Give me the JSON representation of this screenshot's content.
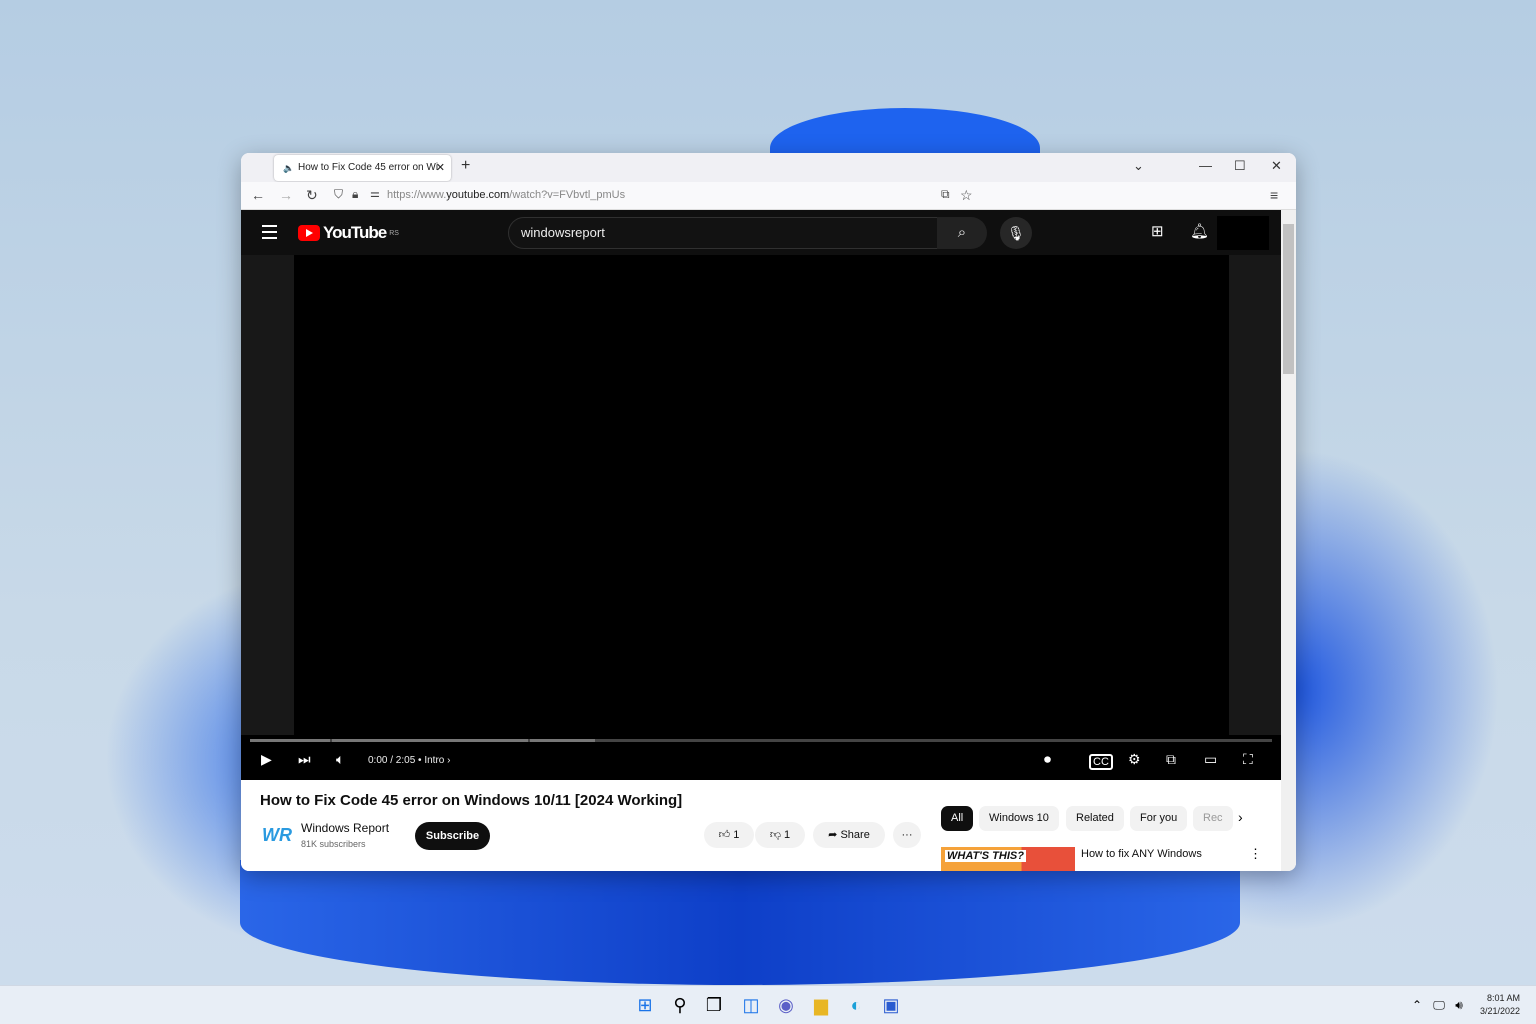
{
  "browser": {
    "tab_title": "How to Fix Code 45 error on Wi",
    "url_prefix": "https://www.",
    "url_domain": "youtube.com",
    "url_path": "/watch?v=FVbvtl_pmUs"
  },
  "youtube": {
    "logo": "YouTube",
    "region": "RS",
    "search_value": "windowsreport",
    "player": {
      "time": "0:00 / 2:05",
      "chapter": "• Intro ›",
      "progress": 0
    },
    "video_title": "How to Fix Code 45 error on Windows 10/11 [2024 Working]",
    "channel": {
      "logo": "WR",
      "name": "Windows Report",
      "subscribers": "81K subscribers"
    },
    "subscribe": "Subscribe",
    "likes": "1",
    "dislikes": "1",
    "share": "Share",
    "more": "···",
    "chips": [
      "All",
      "Windows 10",
      "Related",
      "For you",
      "Rec"
    ],
    "recommended": {
      "thumb_text": "WHAT'S THIS?",
      "title": "How to fix ANY Windows"
    }
  },
  "taskbar": {
    "time": "8:01 AM",
    "date": "3/21/2022"
  }
}
